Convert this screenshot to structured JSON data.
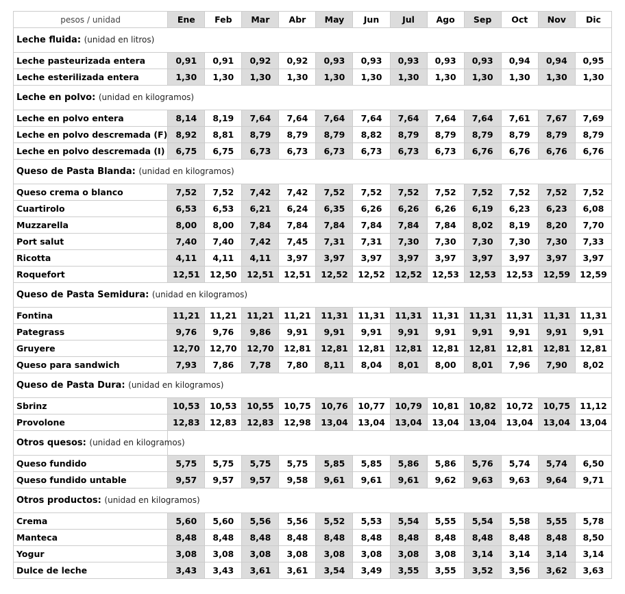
{
  "header": {
    "label": "pesos / unidad",
    "months": [
      "Ene",
      "Feb",
      "Mar",
      "Abr",
      "May",
      "Jun",
      "Jul",
      "Ago",
      "Sep",
      "Oct",
      "Nov",
      "Dic"
    ]
  },
  "sections": [
    {
      "title": "Leche fluida:",
      "unit": "(unidad en litros)",
      "split": false,
      "rows": [
        {
          "name": "Leche pasteurizada entera",
          "values": [
            "0,91",
            "0,91",
            "0,92",
            "0,92",
            "0,93",
            "0,93",
            "0,93",
            "0,93",
            "0,93",
            "0,94",
            "0,94",
            "0,95"
          ]
        },
        {
          "name": "Leche esterilizada entera",
          "values": [
            "1,30",
            "1,30",
            "1,30",
            "1,30",
            "1,30",
            "1,30",
            "1,30",
            "1,30",
            "1,30",
            "1,30",
            "1,30",
            "1,30"
          ]
        }
      ]
    },
    {
      "title": "Leche en polvo:",
      "unit": "(unidad en kilogramos)",
      "split": false,
      "rows": [
        {
          "name": "Leche en polvo entera",
          "values": [
            "8,14",
            "8,19",
            "7,64",
            "7,64",
            "7,64",
            "7,64",
            "7,64",
            "7,64",
            "7,64",
            "7,61",
            "7,67",
            "7,69"
          ]
        },
        {
          "name": "Leche en polvo descremada (F)",
          "values": [
            "8,92",
            "8,81",
            "8,79",
            "8,79",
            "8,79",
            "8,82",
            "8,79",
            "8,79",
            "8,79",
            "8,79",
            "8,79",
            "8,79"
          ]
        },
        {
          "name": "Leche en polvo descremada (I)",
          "values": [
            "6,75",
            "6,75",
            "6,73",
            "6,73",
            "6,73",
            "6,73",
            "6,73",
            "6,73",
            "6,76",
            "6,76",
            "6,76",
            "6,76"
          ]
        }
      ]
    },
    {
      "title": "Queso de Pasta Blanda:",
      "unit": "(unidad en kilogramos)",
      "split": false,
      "rows": [
        {
          "name": "Queso crema o blanco",
          "values": [
            "7,52",
            "7,52",
            "7,42",
            "7,42",
            "7,52",
            "7,52",
            "7,52",
            "7,52",
            "7,52",
            "7,52",
            "7,52",
            "7,52"
          ]
        },
        {
          "name": "Cuartirolo",
          "values": [
            "6,53",
            "6,53",
            "6,21",
            "6,24",
            "6,35",
            "6,26",
            "6,26",
            "6,26",
            "6,19",
            "6,23",
            "6,23",
            "6,08"
          ]
        },
        {
          "name": "Muzzarella",
          "values": [
            "8,00",
            "8,00",
            "7,84",
            "7,84",
            "7,84",
            "7,84",
            "7,84",
            "7,84",
            "8,02",
            "8,19",
            "8,20",
            "7,70"
          ]
        },
        {
          "name": "Port salut",
          "values": [
            "7,40",
            "7,40",
            "7,42",
            "7,45",
            "7,31",
            "7,31",
            "7,30",
            "7,30",
            "7,30",
            "7,30",
            "7,30",
            "7,33"
          ]
        },
        {
          "name": "Ricotta",
          "values": [
            "4,11",
            "4,11",
            "4,11",
            "3,97",
            "3,97",
            "3,97",
            "3,97",
            "3,97",
            "3,97",
            "3,97",
            "3,97",
            "3,97"
          ]
        },
        {
          "name": "Roquefort",
          "values": [
            "12,51",
            "12,50",
            "12,51",
            "12,51",
            "12,52",
            "12,52",
            "12,52",
            "12,53",
            "12,53",
            "12,53",
            "12,59",
            "12,59"
          ]
        }
      ]
    },
    {
      "title": "Queso de Pasta  Semidura:",
      "unit": "(unidad en kilogramos)",
      "split": false,
      "rows": [
        {
          "name": "Fontina",
          "values": [
            "11,21",
            "11,21",
            "11,21",
            "11,21",
            "11,31",
            "11,31",
            "11,31",
            "11,31",
            "11,31",
            "11,31",
            "11,31",
            "11,31"
          ]
        },
        {
          "name": "Pategrass",
          "values": [
            "9,76",
            "9,76",
            "9,86",
            "9,91",
            "9,91",
            "9,91",
            "9,91",
            "9,91",
            "9,91",
            "9,91",
            "9,91",
            "9,91"
          ]
        },
        {
          "name": "Gruyere",
          "values": [
            "12,70",
            "12,70",
            "12,70",
            "12,81",
            "12,81",
            "12,81",
            "12,81",
            "12,81",
            "12,81",
            "12,81",
            "12,81",
            "12,81"
          ]
        },
        {
          "name": "Queso para sandwich",
          "values": [
            "7,93",
            "7,86",
            "7,78",
            "7,80",
            "8,11",
            "8,04",
            "8,01",
            "8,00",
            "8,01",
            "7,96",
            "7,90",
            "8,02"
          ]
        }
      ]
    },
    {
      "title": "Queso de Pasta Dura:",
      "unit": "(unidad en kilogramos)",
      "split": false,
      "rows": [
        {
          "name": "Sbrinz",
          "values": [
            "10,53",
            "10,53",
            "10,55",
            "10,75",
            "10,76",
            "10,77",
            "10,79",
            "10,81",
            "10,82",
            "10,72",
            "10,75",
            "11,12"
          ]
        },
        {
          "name": "Provolone",
          "values": [
            "12,83",
            "12,83",
            "12,83",
            "12,98",
            "13,04",
            "13,04",
            "13,04",
            "13,04",
            "13,04",
            "13,04",
            "13,04",
            "13,04"
          ]
        }
      ]
    },
    {
      "title": "Otros quesos:",
      "unit": "(unidad en kilogramos)",
      "split": true,
      "rows": [
        {
          "name": "Queso fundido",
          "values": [
            "5,75",
            "5,75",
            "5,75",
            "5,75",
            "5,85",
            "5,85",
            "5,86",
            "5,86",
            "5,76",
            "5,74",
            "5,74",
            "6,50"
          ]
        },
        {
          "name": "Queso fundido untable",
          "values": [
            "9,57",
            "9,57",
            "9,57",
            "9,58",
            "9,61",
            "9,61",
            "9,61",
            "9,62",
            "9,63",
            "9,63",
            "9,64",
            "9,71"
          ]
        }
      ]
    },
    {
      "title": "Otros productos:",
      "unit": "(unidad en kilogramos)",
      "split": false,
      "rows": [
        {
          "name": "Crema",
          "values": [
            "5,60",
            "5,60",
            "5,56",
            "5,56",
            "5,52",
            "5,53",
            "5,54",
            "5,55",
            "5,54",
            "5,58",
            "5,55",
            "5,78"
          ]
        },
        {
          "name": "Manteca",
          "values": [
            "8,48",
            "8,48",
            "8,48",
            "8,48",
            "8,48",
            "8,48",
            "8,48",
            "8,48",
            "8,48",
            "8,48",
            "8,48",
            "8,50"
          ]
        },
        {
          "name": "Yogur",
          "values": [
            "3,08",
            "3,08",
            "3,08",
            "3,08",
            "3,08",
            "3,08",
            "3,08",
            "3,08",
            "3,14",
            "3,14",
            "3,14",
            "3,14"
          ]
        },
        {
          "name": "Dulce de leche",
          "values": [
            "3,43",
            "3,43",
            "3,61",
            "3,61",
            "3,54",
            "3,49",
            "3,55",
            "3,55",
            "3,52",
            "3,56",
            "3,62",
            "3,63"
          ]
        }
      ]
    }
  ],
  "colors": {
    "shade": "#dcdcdc",
    "border": "#cccccc"
  }
}
